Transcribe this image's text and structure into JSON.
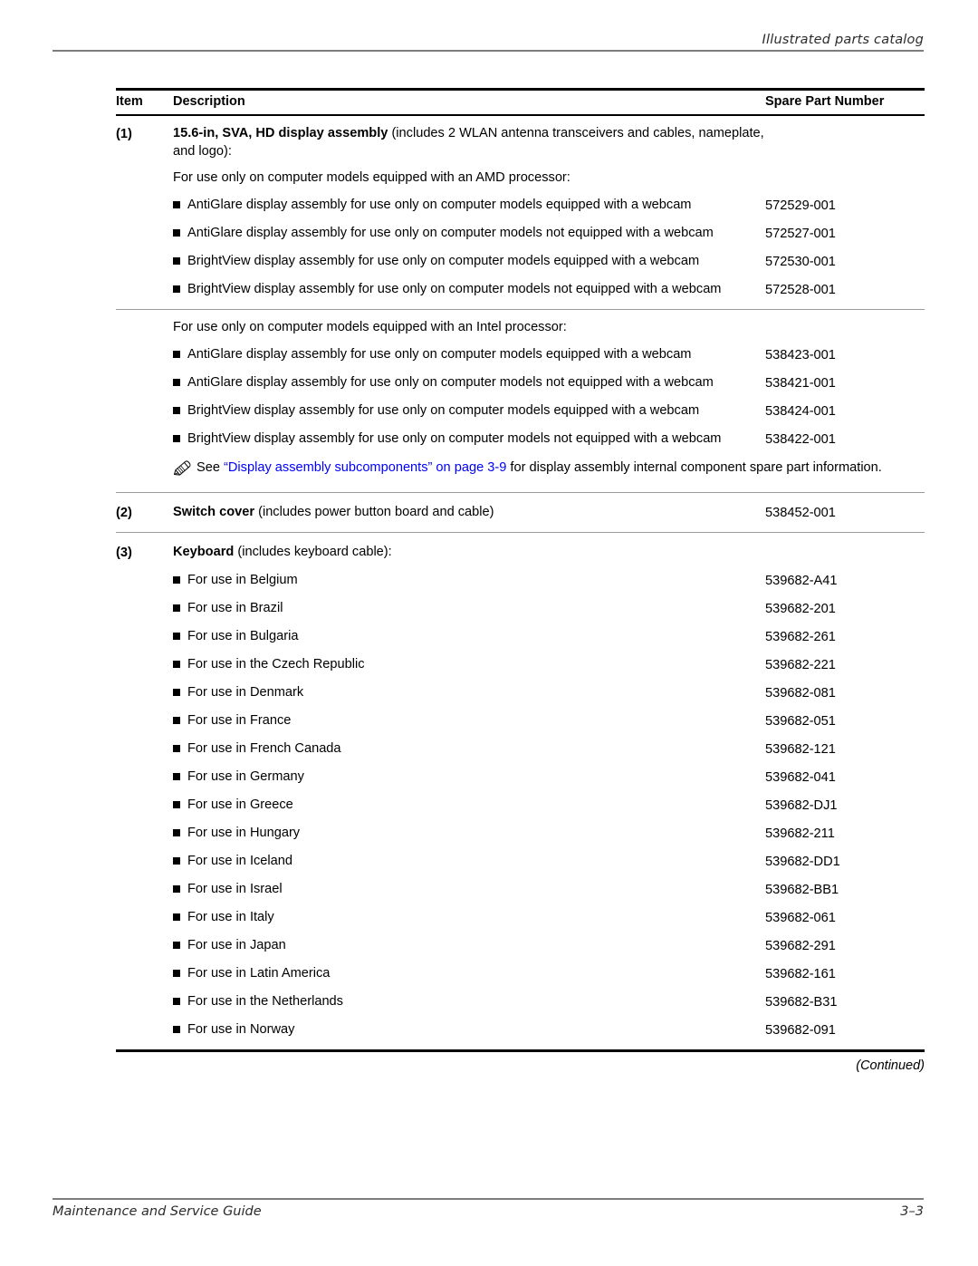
{
  "header": {
    "running_head": "Illustrated parts catalog"
  },
  "footer": {
    "guide_title": "Maintenance and Service Guide",
    "page_number": "3–3"
  },
  "table": {
    "columns": {
      "item": "Item",
      "description": "Description",
      "spare_part_number": "Spare Part Number"
    },
    "continued_label": "(Continued)",
    "rows": [
      {
        "item": "(1)",
        "title_bold": "15.6-in, SVA, HD display assembly",
        "title_rest": " (includes 2 WLAN antenna transceivers and cables, nameplate, and logo):",
        "amd_heading": "For use only on computer models equipped with an AMD processor:",
        "amd_bullets": [
          {
            "text": "AntiGlare display assembly for use only on computer models equipped with a webcam",
            "part": "572529-001"
          },
          {
            "text": "AntiGlare display assembly for use only on computer models not equipped with a webcam",
            "part": "572527-001"
          },
          {
            "text": "BrightView display assembly for use only on computer models equipped with a webcam",
            "part": "572530-001"
          },
          {
            "text": "BrightView display assembly for use only on computer models not equipped with a webcam",
            "part": "572528-001"
          }
        ],
        "intel_heading": "For use only on computer models equipped with an Intel processor:",
        "intel_bullets": [
          {
            "text": "AntiGlare display assembly for use only on computer models equipped with a webcam",
            "part": "538423-001"
          },
          {
            "text": "AntiGlare display assembly for use only on computer models not equipped with a webcam",
            "part": "538421-001"
          },
          {
            "text": "BrightView display assembly for use only on computer models equipped with a webcam",
            "part": "538424-001"
          },
          {
            "text": "BrightView display assembly for use only on computer models not equipped with a webcam",
            "part": "538422-001"
          }
        ],
        "note": {
          "icon": "pencil-note-icon",
          "prefix": "See ",
          "link": "“Display assembly subcomponents” on page 3-9",
          "suffix": " for display assembly internal component spare part information."
        }
      },
      {
        "item": "(2)",
        "title_bold": "Switch cover",
        "title_rest": " (includes power button board and cable)",
        "part": "538452-001"
      },
      {
        "item": "(3)",
        "title_bold": "Keyboard",
        "title_rest": " (includes keyboard cable):",
        "keyboard_bullets": [
          {
            "text": "For use in Belgium",
            "part": "539682-A41"
          },
          {
            "text": "For use in Brazil",
            "part": "539682-201"
          },
          {
            "text": "For use in Bulgaria",
            "part": "539682-261"
          },
          {
            "text": "For use in the Czech Republic",
            "part": "539682-221"
          },
          {
            "text": "For use in Denmark",
            "part": "539682-081"
          },
          {
            "text": "For use in France",
            "part": "539682-051"
          },
          {
            "text": "For use in French Canada",
            "part": "539682-121"
          },
          {
            "text": "For use in Germany",
            "part": "539682-041"
          },
          {
            "text": "For use in Greece",
            "part": "539682-DJ1"
          },
          {
            "text": "For use in Hungary",
            "part": "539682-211"
          },
          {
            "text": "For use in Iceland",
            "part": "539682-DD1"
          },
          {
            "text": "For use in Israel",
            "part": "539682-BB1"
          },
          {
            "text": "For use in Italy",
            "part": "539682-061"
          },
          {
            "text": "For use in Japan",
            "part": "539682-291"
          },
          {
            "text": "For use in Latin America",
            "part": "539682-161"
          },
          {
            "text": "For use in the Netherlands",
            "part": "539682-B31"
          },
          {
            "text": "For use in Norway",
            "part": "539682-091"
          }
        ]
      }
    ]
  },
  "colors": {
    "link": "#0000FF",
    "rule_gray": "#7D7D7D",
    "rule_black": "#000000"
  }
}
